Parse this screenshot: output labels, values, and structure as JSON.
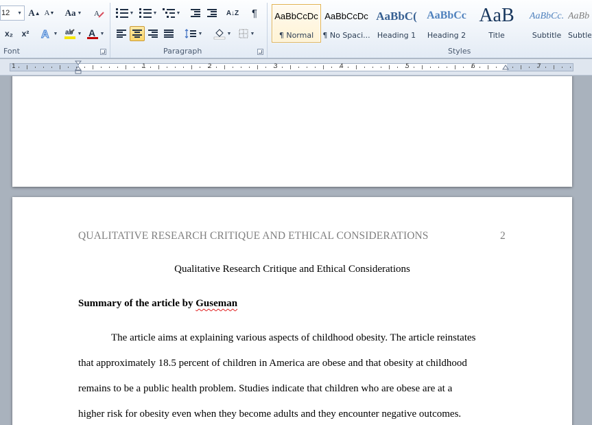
{
  "ribbon": {
    "font": {
      "size_value": "12",
      "grow_label": "A",
      "shrink_label": "A",
      "change_case_label": "Aa",
      "subscript_label": "x₂",
      "superscript_label": "x²",
      "font_color_label": "A",
      "group_label": "Font"
    },
    "paragraph": {
      "group_label": "Paragraph",
      "sort_label": "A↓Z",
      "show_marks_label": "¶"
    },
    "styles": {
      "group_label": "Styles",
      "items": [
        {
          "preview": "AaBbCcDc",
          "name": "¶ Normal"
        },
        {
          "preview": "AaBbCcDc",
          "name": "¶ No Spaci..."
        },
        {
          "preview": "AaBbC(",
          "name": "Heading 1"
        },
        {
          "preview": "AaBbCc",
          "name": "Heading 2"
        },
        {
          "preview": "AaB",
          "name": "Title"
        },
        {
          "preview": "AaBbCc.",
          "name": "Subtitle"
        },
        {
          "preview": "AaBb",
          "name": "Subtle"
        }
      ]
    },
    "colors": {
      "highlight": "#f5e500",
      "font_color": "#c00000",
      "heading": "#365f91",
      "heading2": "#4f81bd",
      "title": "#17365d",
      "subtitle": "#4f81bd"
    }
  },
  "ruler": {
    "numbers": [
      "1",
      "1",
      "2",
      "3",
      "4",
      "5",
      "6",
      "7"
    ]
  },
  "document": {
    "running_head": "QUALITATIVE RESEARCH CRITIQUE AND ETHICAL CONSIDERATIONS",
    "page_number": "2",
    "title": "Qualitative Research Critique and Ethical Considerations",
    "section_heading_prefix": "Summary of the article by ",
    "section_heading_name": "Guseman",
    "body_lines": [
      "The article aims at explaining various aspects of childhood obesity. The article reinstates",
      "that approximately 18.5 percent of children in America are obese and that obesity at childhood",
      "remains to be a public health problem.  Studies indicate that children who are obese are at a",
      "higher risk for obesity even when they become adults and they encounter negative outcomes."
    ]
  }
}
